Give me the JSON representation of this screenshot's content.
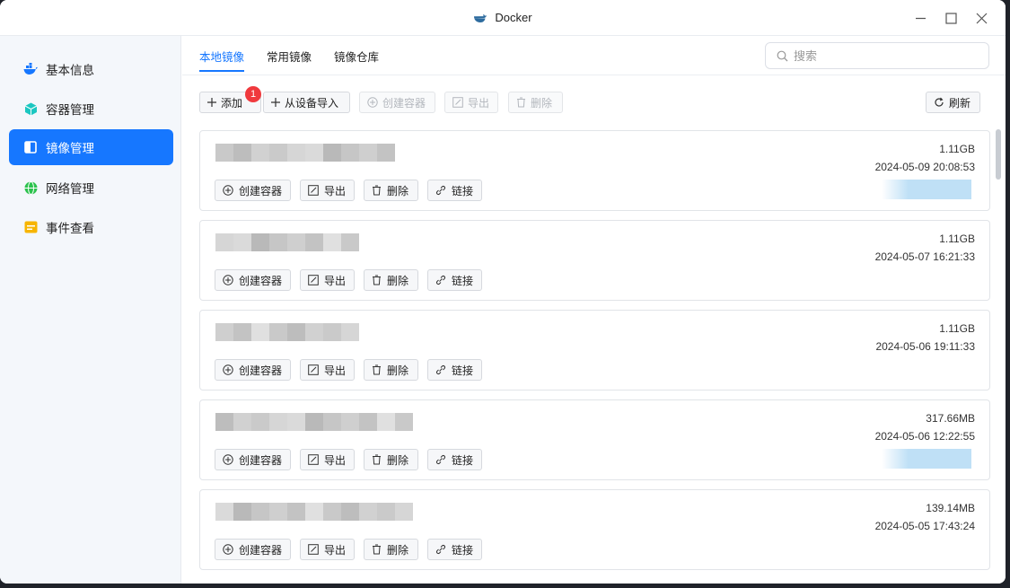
{
  "window": {
    "title": "Docker"
  },
  "sidebar": {
    "items": [
      {
        "label": "基本信息",
        "icon": "docker-whale-icon",
        "color": "#1677ff"
      },
      {
        "label": "容器管理",
        "icon": "cube-icon",
        "color": "#1bc7c1"
      },
      {
        "label": "镜像管理",
        "icon": "image-icon",
        "color": "#ffffff"
      },
      {
        "label": "网络管理",
        "icon": "globe-icon",
        "color": "#2bc24d"
      },
      {
        "label": "事件查看",
        "icon": "event-icon",
        "color": "#f7b500"
      }
    ]
  },
  "tabs": [
    {
      "label": "本地镜像"
    },
    {
      "label": "常用镜像"
    },
    {
      "label": "镜像仓库"
    }
  ],
  "search": {
    "placeholder": "搜索"
  },
  "toolbar": {
    "add_label": "添加",
    "badge_count": "1",
    "import_label": "从设备导入",
    "create_label": "创建容器",
    "export_label": "导出",
    "delete_label": "删除",
    "refresh_label": "刷新"
  },
  "card_buttons": {
    "create": "创建容器",
    "export": "导出",
    "delete": "删除",
    "link": "链接"
  },
  "images": [
    {
      "size": "1.11GB",
      "date": "2024-05-09 20:08:53"
    },
    {
      "size": "1.11GB",
      "date": "2024-05-07 16:21:33"
    },
    {
      "size": "1.11GB",
      "date": "2024-05-06 19:11:33"
    },
    {
      "size": "317.66MB",
      "date": "2024-05-06 12:22:55"
    },
    {
      "size": "139.14MB",
      "date": "2024-05-05 17:43:24"
    }
  ],
  "colors": {
    "accent": "#1677ff",
    "badge": "#f0393d"
  }
}
